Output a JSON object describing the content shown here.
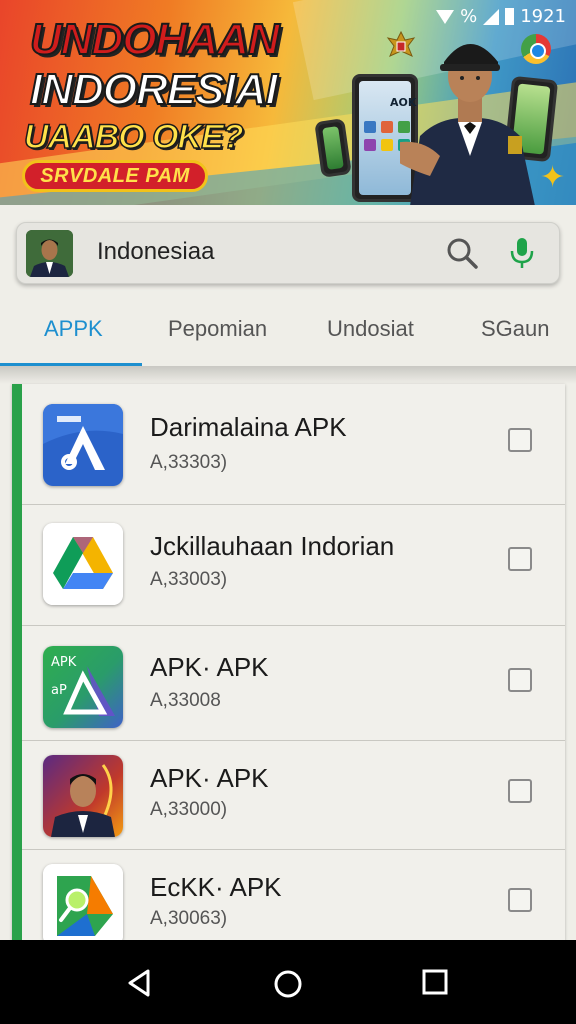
{
  "banner": {
    "headline_1": "UNDOHAAN",
    "headline_2": "INDORESIAI",
    "headline_3": "UAABO OKE?",
    "pill_label": "SRVDALE PAM",
    "phone_text": "AOK"
  },
  "status_bar": {
    "percent_symbol": "%",
    "time": "1921"
  },
  "search": {
    "query": "Indonesiaa"
  },
  "tabs": [
    {
      "label": "APPK",
      "active": true
    },
    {
      "label": "Pepomian",
      "active": false
    },
    {
      "label": "Undosiat",
      "active": false
    },
    {
      "label": "SGaun",
      "active": false
    }
  ],
  "apps": [
    {
      "title": "Darimalaina APK",
      "subtitle": "A,33303)",
      "icon": "blue-a-icon",
      "checked": false
    },
    {
      "title": "Jckillauhaan Indorian",
      "subtitle": "A,33003)",
      "icon": "drive-triangle-icon",
      "checked": false
    },
    {
      "title": "APK· APK",
      "subtitle": "A,33008",
      "icon": "apk-green-icon",
      "checked": false,
      "icon_text_1": "APK",
      "icon_text_2": "aP"
    },
    {
      "title": "APK· APK",
      "subtitle": "A,33000)",
      "icon": "presenter-photo-icon",
      "checked": false
    },
    {
      "title": "EcKK· APK",
      "subtitle": "A,30063)",
      "icon": "green-search-icon",
      "checked": false
    }
  ],
  "colors": {
    "accent_green": "#2aa14a",
    "tab_active": "#1d8fcf",
    "nav_bar": "#000000"
  }
}
